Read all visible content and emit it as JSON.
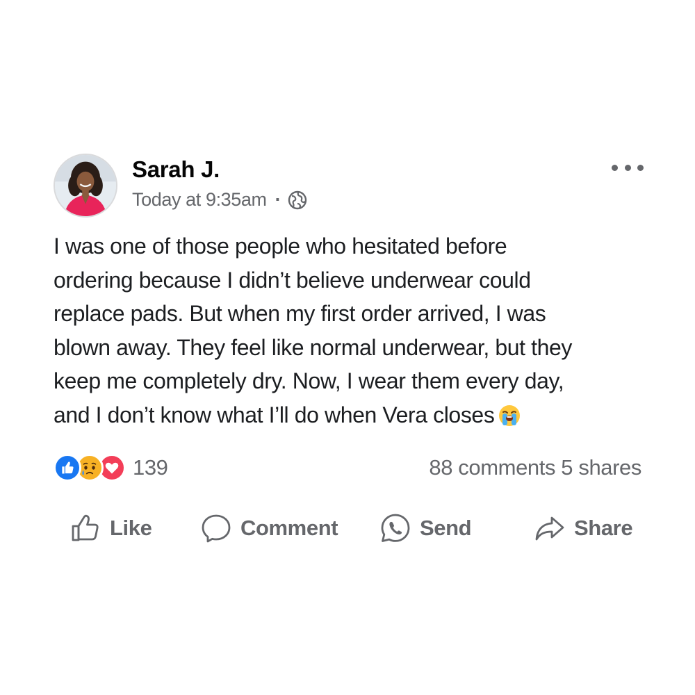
{
  "post": {
    "author": "Sarah J.",
    "timestamp": "Today at 9:35am",
    "separator": "·",
    "privacy_icon": "globe-icon",
    "body_lines": [
      "I was one of those people who hesitated before",
      "ordering because I didn’t believe underwear could",
      "replace pads. But when my first order arrived, I was",
      "blown away. They feel like normal underwear, but they",
      "keep me completely dry. Now, I wear them every day,",
      "and I don’t know what I’ll do when Vera closes"
    ],
    "body_end_emoji": "loudly-crying-face-emoji"
  },
  "reactions": {
    "icons": [
      "like-reaction-icon",
      "sad-reaction-icon",
      "love-reaction-icon"
    ],
    "count": "139",
    "comments": "88 comments",
    "shares": "5 shares"
  },
  "actions": {
    "like": "Like",
    "comment": "Comment",
    "send": "Send",
    "share": "Share"
  },
  "colors": {
    "text_secondary": "#65676b",
    "like_blue": "#1877f2",
    "love_red": "#f33e58",
    "sad_yellow": "#f7b125"
  }
}
